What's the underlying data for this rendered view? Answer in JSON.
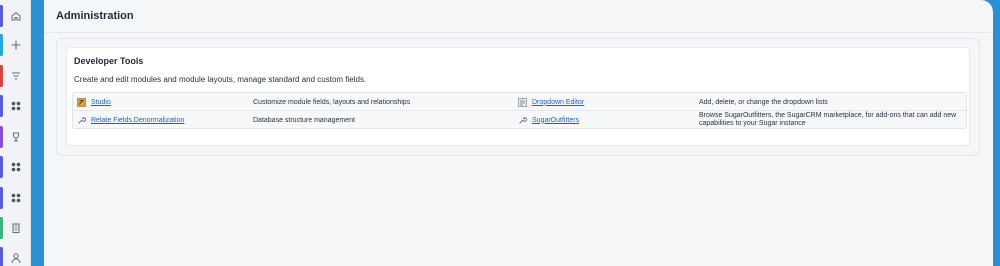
{
  "sidebar": {
    "items": [
      {
        "icon": "home-icon",
        "accent": "#5b5bd6"
      },
      {
        "icon": "plus-icon",
        "accent": "#2aa7d6"
      },
      {
        "icon": "filter-icon",
        "accent": "#d64545"
      },
      {
        "icon": "grid-icon",
        "accent": "#5b5bd6"
      },
      {
        "icon": "trophy-icon",
        "accent": "#8b4fd6"
      },
      {
        "icon": "grid-icon",
        "accent": "#5b5bd6"
      },
      {
        "icon": "grid-icon",
        "accent": "#5b5bd6"
      },
      {
        "icon": "building-icon",
        "accent": "#3fb37f"
      },
      {
        "icon": "user-icon",
        "accent": "#5b5bd6"
      }
    ]
  },
  "page": {
    "title": "Administration"
  },
  "developer_tools": {
    "title": "Developer Tools",
    "description": "Create and edit modules and module layouts, manage standard and custom fields.",
    "rows": [
      {
        "left": {
          "icon": "studio-icon",
          "label": "Studio",
          "description": "Customize module fields, layouts and relationships"
        },
        "right": {
          "icon": "dropdown-editor-icon",
          "label": "Dropdown Editor",
          "description": "Add, delete, or change the dropdown lists"
        }
      },
      {
        "left": {
          "icon": "wrench-icon",
          "label": "Relate Fields Denormalization",
          "description": "Database structure management"
        },
        "right": {
          "icon": "wrench-icon",
          "label": "SugarOutfitters",
          "description": "Browse SugarOutfitters, the SugarCRM marketplace, for add-ons that can add new capabilities to your Sugar instance"
        }
      }
    ]
  },
  "colors": {
    "brand_blue": "#2b8fd6",
    "link": "#1a62b8"
  }
}
